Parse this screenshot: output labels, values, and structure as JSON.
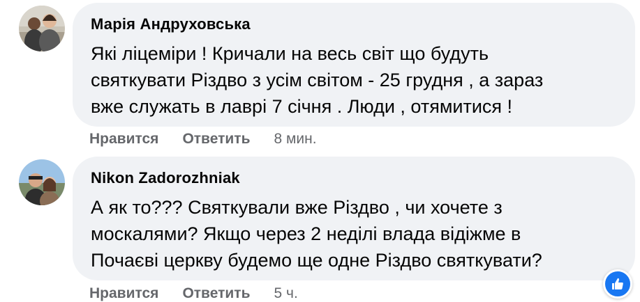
{
  "comments": [
    {
      "author": "Марія Андруховська",
      "text": "Які ліцеміри ! Кричали на весь світ що будуть\nсвяткувати Різдво з усім світом - 25 грудня , а зараз\nвже служать в лаврі 7 січня . Люди , отямитися !",
      "like_label": "Нравится",
      "reply_label": "Ответить",
      "time": "8 мин."
    },
    {
      "author": "Nikon Zadorozhniak",
      "text": "А як то??? Святкували вже Різдво , чи хочете з\nмоскалями? Якщо через 2 неділі влада відіжме в\nПочаєві церкву будемо ще одне Різдво святкувати?",
      "like_label": "Нравится",
      "reply_label": "Ответить",
      "time": "5 ч."
    }
  ],
  "reaction": {
    "icon": "thumbs-up-icon",
    "color": "#1877f2"
  }
}
